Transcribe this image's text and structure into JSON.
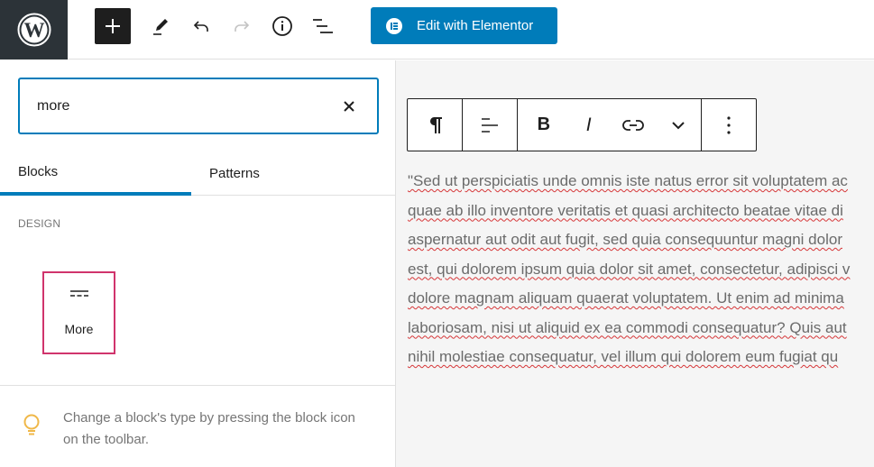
{
  "topbar": {
    "logo": "wordpress-logo",
    "buttons": [
      {
        "name": "add-block",
        "icon": "plus-icon",
        "active": true
      },
      {
        "name": "tools",
        "icon": "pencil-icon"
      },
      {
        "name": "undo",
        "icon": "undo-icon"
      },
      {
        "name": "redo",
        "icon": "redo-icon",
        "disabled": true
      },
      {
        "name": "details",
        "icon": "info-icon"
      },
      {
        "name": "list-view",
        "icon": "list-view-icon"
      }
    ],
    "elementor_label": "Edit with Elementor",
    "colors": {
      "logo_bg": "#2c3338",
      "accent": "#007cba"
    }
  },
  "inserter": {
    "search_value": "more",
    "search_placeholder": "Search",
    "tabs": [
      {
        "label": "Blocks",
        "active": true
      },
      {
        "label": "Patterns",
        "active": false
      }
    ],
    "category": "DESIGN",
    "blocks": [
      {
        "label": "More",
        "icon": "more-icon",
        "highlighted": true
      }
    ],
    "tip": "Change a block's type by pressing the block icon on the toolbar.",
    "highlight_color": "#d0346c"
  },
  "block_toolbar": {
    "buttons": [
      "paragraph-icon",
      "align-icon",
      "bold-icon",
      "italic-icon",
      "link-icon",
      "more-options-chevron-icon",
      "options-kebab-icon"
    ]
  },
  "paragraph": {
    "lines": [
      "\"Sed ut perspiciatis unde omnis iste natus error sit voluptatem ac",
      "quae ab illo inventore veritatis et quasi architecto beatae vitae di",
      "aspernatur aut odit aut fugit, sed quia consequuntur magni dolor",
      "est, qui dolorem ipsum quia dolor sit amet, consectetur, adipisci v",
      "dolore magnam aliquam quaerat voluptatem. Ut enim ad minima",
      "laboriosam, nisi ut aliquid ex ea commodi consequatur? Quis aut",
      "nihil molestiae consequatur, vel illum qui dolorem eum fugiat qu"
    ]
  }
}
